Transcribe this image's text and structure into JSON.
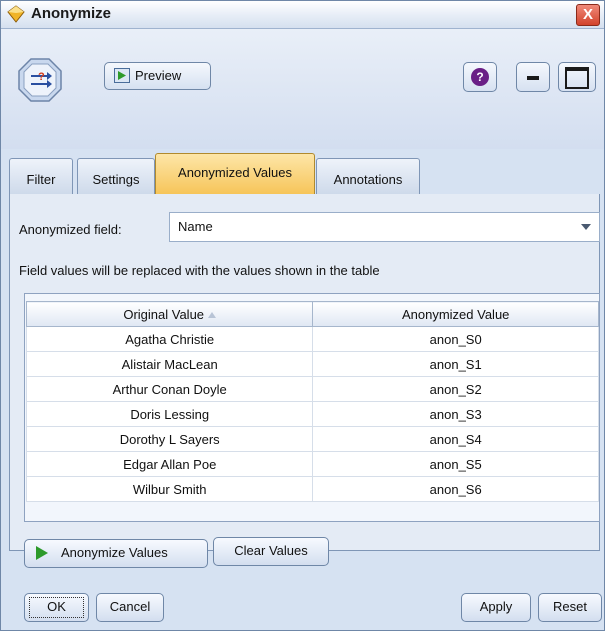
{
  "window": {
    "title": "Anonymize",
    "close_symbol": "X"
  },
  "toolbar": {
    "preview_label": "Preview",
    "help_symbol": "?"
  },
  "tabs": [
    {
      "label": "Filter"
    },
    {
      "label": "Settings"
    },
    {
      "label": "Anonymized Values",
      "active": true
    },
    {
      "label": "Annotations"
    }
  ],
  "field": {
    "label": "Anonymized field:",
    "value": "Name"
  },
  "info_text": "Field values will be replaced with the values shown in the table",
  "table": {
    "columns": [
      "Original Value",
      "Anonymized Value"
    ],
    "rows": [
      [
        "Agatha Christie",
        "anon_S0"
      ],
      [
        "Alistair MacLean",
        "anon_S1"
      ],
      [
        "Arthur Conan Doyle",
        "anon_S2"
      ],
      [
        "Doris Lessing",
        "anon_S3"
      ],
      [
        "Dorothy L Sayers",
        "anon_S4"
      ],
      [
        "Edgar Allan Poe",
        "anon_S5"
      ],
      [
        "Wilbur Smith",
        "anon_S6"
      ]
    ]
  },
  "buttons": {
    "anonymize_values": "Anonymize Values",
    "clear_values": "Clear Values",
    "ok": "OK",
    "cancel": "Cancel",
    "apply": "Apply",
    "reset": "Reset"
  },
  "colors": {
    "active_tab": "#f6c355",
    "window_bg": "#d6e2f2",
    "play_green": "#2d9a2a"
  }
}
